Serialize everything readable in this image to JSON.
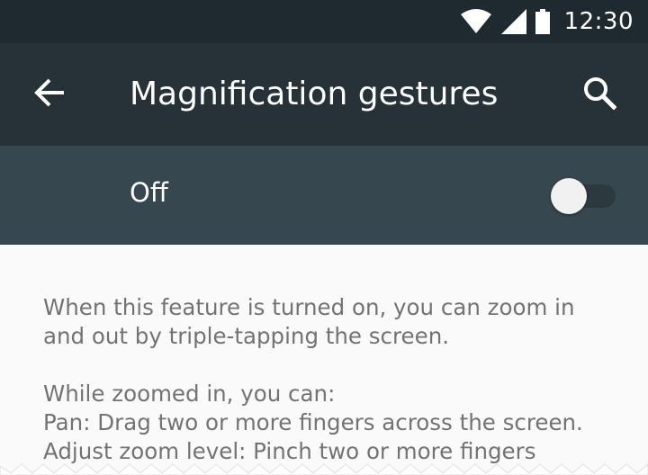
{
  "status_bar": {
    "time": "12:30",
    "icons": [
      "wifi-icon",
      "cell-signal-icon",
      "battery-icon"
    ]
  },
  "app_bar": {
    "title": "Magnification gestures",
    "back_icon": "arrow-back-icon",
    "search_icon": "search-icon"
  },
  "switch_bar": {
    "label": "Off",
    "toggle_checked": false
  },
  "content": {
    "paragraph_1": "When this feature is turned on, you can zoom in\nand out by triple-tapping the screen.",
    "paragraph_2": "While zoomed in, you can:\nPan: Drag two or more fingers across the screen.\nAdjust zoom level: Pinch two or more fingers"
  },
  "colors": {
    "status_bar": "#1f2a30",
    "app_bar": "#263238",
    "switch_bar": "#37474f",
    "background": "#fafafa",
    "body_text": "#737373"
  }
}
